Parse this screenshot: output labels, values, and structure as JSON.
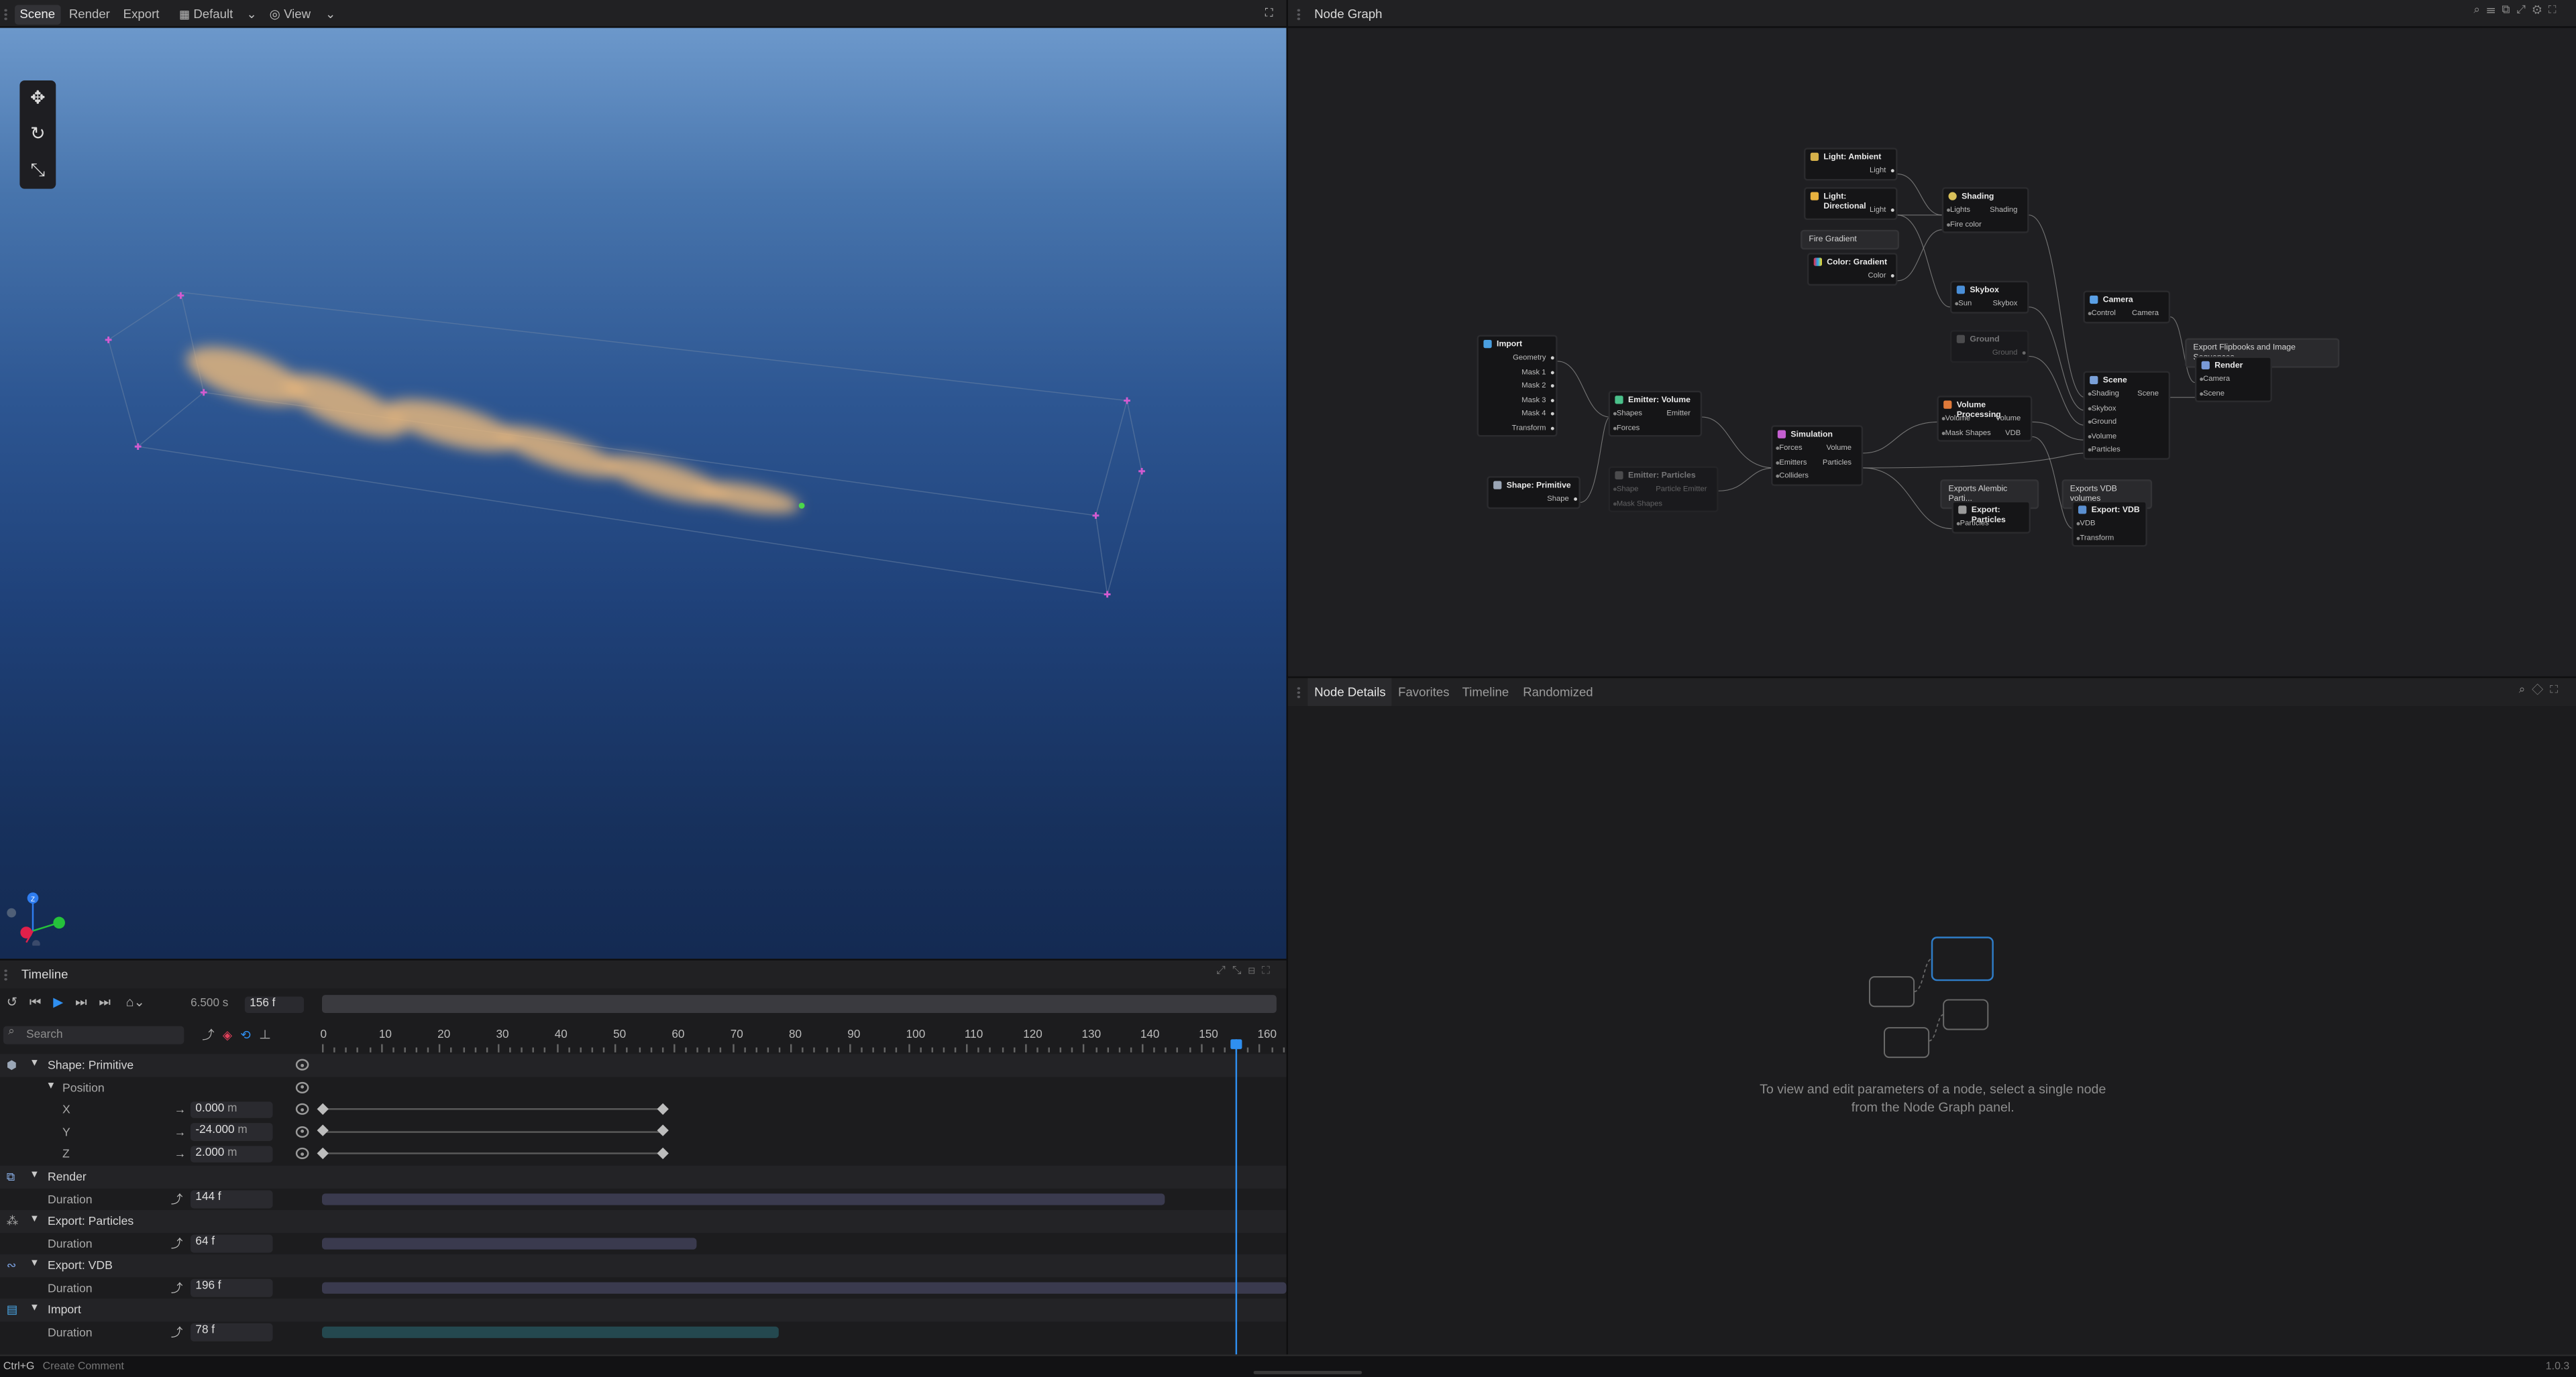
{
  "menu": {
    "tabs": [
      "Scene",
      "Render",
      "Export"
    ],
    "active": "Scene",
    "layout": "Default",
    "view": "View"
  },
  "node_graph": {
    "title": "Node Graph",
    "groups": [
      "Fire Gradient",
      "Exports Alembic Parti...",
      "Exports VDB volumes",
      "Export Flipbooks and Image Sequences"
    ],
    "nodes": {
      "light_ambient": {
        "title": "Light: Ambient",
        "out": "Light"
      },
      "light_directional": {
        "title": "Light: Directional",
        "out": "Light"
      },
      "color_gradient": {
        "title": "Color: Gradient",
        "out": "Color"
      },
      "shading": {
        "title": "Shading",
        "in1": "Lights",
        "in2": "Fire color",
        "out": "Shading"
      },
      "skybox": {
        "title": "Skybox",
        "in": "Sun",
        "out": "Skybox"
      },
      "ground": {
        "title": "Ground",
        "out": "Ground"
      },
      "camera": {
        "title": "Camera",
        "in": "Control",
        "out": "Camera"
      },
      "render": {
        "title": "Render",
        "in1": "Camera",
        "in2": "Scene"
      },
      "import": {
        "title": "Import",
        "outs": [
          "Geometry",
          "Mask 1",
          "Mask 2",
          "Mask 3",
          "Mask 4",
          "Transform"
        ]
      },
      "emitter_volume": {
        "title": "Emitter: Volume",
        "in1": "Shapes",
        "in2": "Forces",
        "out": "Emitter"
      },
      "emitter_particles": {
        "title": "Emitter: Particles",
        "in1": "Shape",
        "in2": "Mask Shapes",
        "out": "Particle Emitter"
      },
      "shape_primitive": {
        "title": "Shape: Primitive",
        "out": "Shape"
      },
      "simulation": {
        "title": "Simulation",
        "ins": [
          "Forces",
          "Emitters",
          "Colliders"
        ],
        "out1": "Volume",
        "out2": "Particles"
      },
      "volume_processing": {
        "title": "Volume Processing",
        "in1": "Volume",
        "in2": "Mask Shapes",
        "out1": "Volume",
        "out2": "VDB"
      },
      "scene": {
        "title": "Scene",
        "ins": [
          "Shading",
          "Skybox",
          "Ground",
          "Volume",
          "Particles"
        ],
        "out": "Scene"
      },
      "export_particles": {
        "title": "Export: Particles",
        "in": "Particles"
      },
      "export_vdb": {
        "title": "Export: VDB",
        "in1": "VDB",
        "in2": "Transform"
      }
    }
  },
  "details": {
    "tabs": [
      "Node Details",
      "Favorites",
      "Timeline",
      "Randomized"
    ],
    "active": "Node Details",
    "hint_line1": "To view and edit parameters of a node, select a single node",
    "hint_line2": "from the Node Graph panel.",
    "version": "1.0.3"
  },
  "timeline": {
    "title": "Timeline",
    "time": "6.500",
    "time_unit": "s",
    "frame": "156 f",
    "search_placeholder": "Search",
    "ticks": [
      "0",
      "10",
      "20",
      "30",
      "40",
      "50",
      "60",
      "70",
      "80",
      "90",
      "100",
      "110",
      "120",
      "130",
      "140",
      "150",
      "160"
    ],
    "playhead_frame": 156,
    "max_frame": 164,
    "tracks": {
      "shape": "Shape: Primitive",
      "position": "Position",
      "x": {
        "label": "X",
        "value": "0.000",
        "unit": "m"
      },
      "y": {
        "label": "Y",
        "value": "-24.000",
        "unit": "m"
      },
      "z": {
        "label": "Z",
        "value": "2.000",
        "unit": "m"
      },
      "render": {
        "label": "Render",
        "sub": "Duration",
        "value": "144 f",
        "frames": 144
      },
      "export_particles": {
        "label": "Export: Particles",
        "sub": "Duration",
        "value": "64 f",
        "frames": 64
      },
      "export_vdb": {
        "label": "Export: VDB",
        "sub": "Duration",
        "value": "196 f",
        "frames": 196
      },
      "import": {
        "label": "Import",
        "sub": "Duration",
        "value": "78 f",
        "frames": 78
      }
    },
    "keyframes": [
      0,
      58
    ]
  },
  "status": {
    "shortcut": "Ctrl+G",
    "action": "Create Comment"
  },
  "colors": {
    "accent": "#2f8ff0",
    "playhead": "#2f8ff0",
    "keyframe_red": "#e0405a",
    "gizmo_x": "#e0204a",
    "gizmo_y": "#25c23b",
    "gizmo_z": "#2f7df0"
  }
}
